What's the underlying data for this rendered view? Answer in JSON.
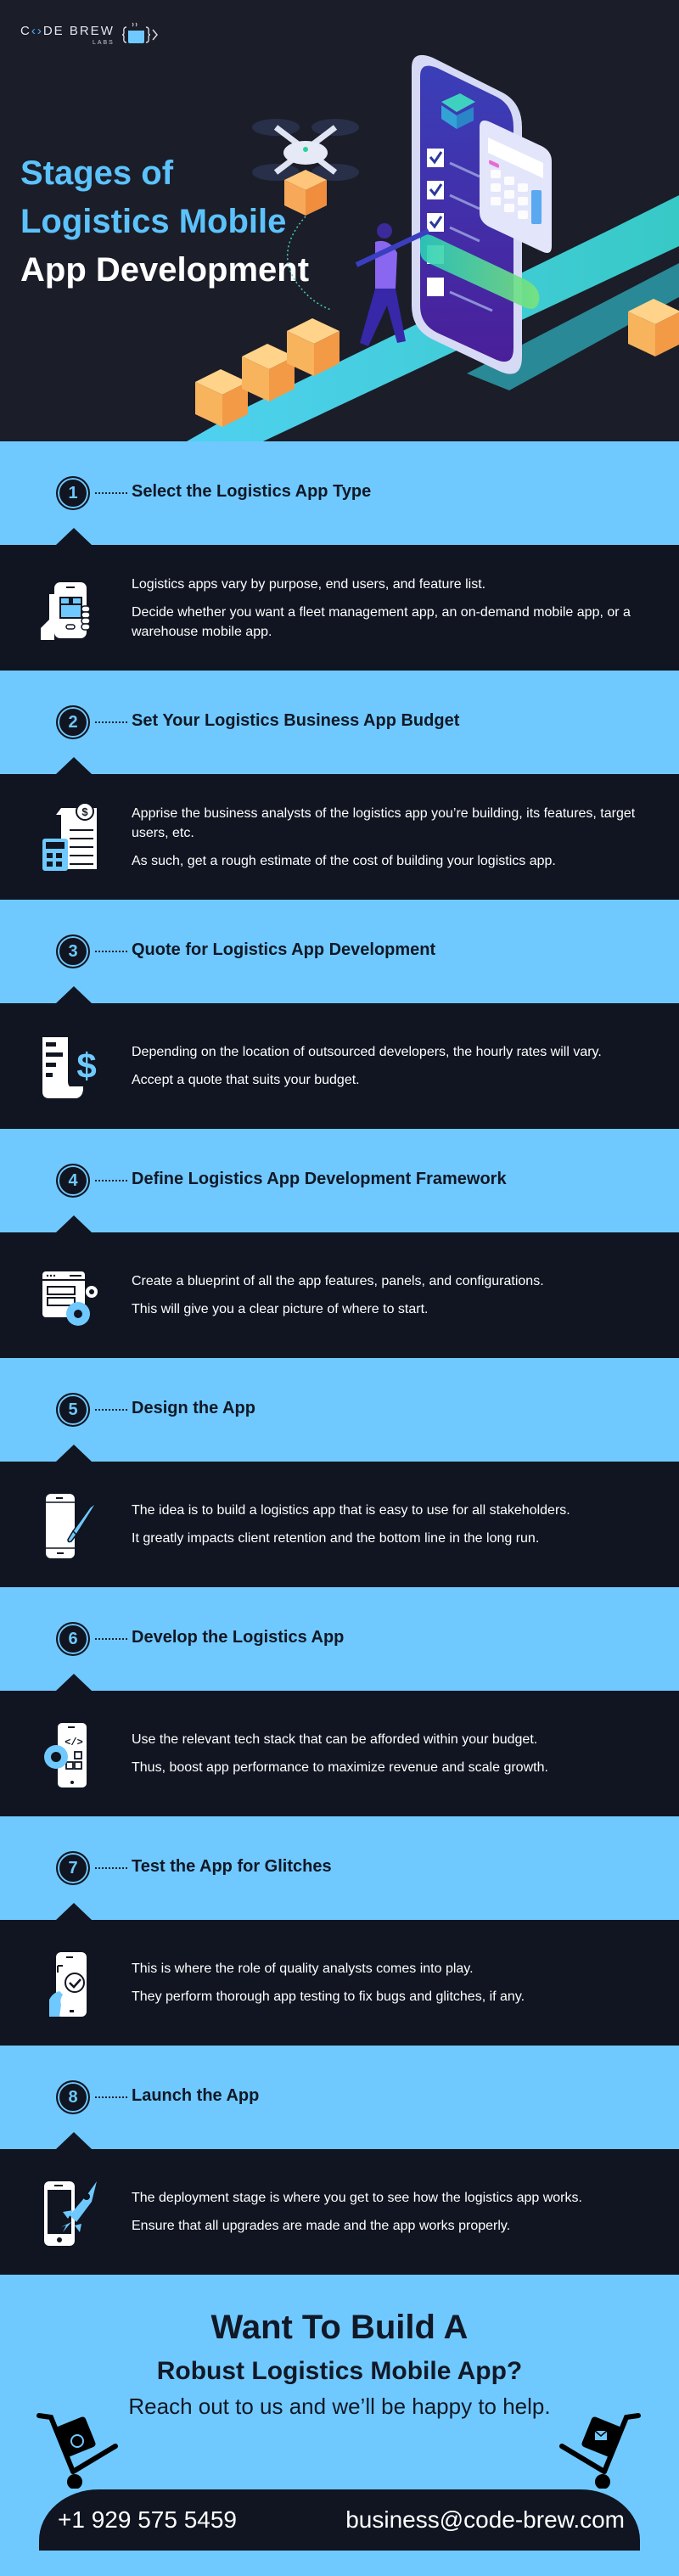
{
  "brand": {
    "name_part1": "C",
    "name_part2": "DE BREW",
    "sub": "LABS",
    "logo_icon": "coffee-cup-braces-icon"
  },
  "hero": {
    "title_line1": "Stages of",
    "title_line2": "Logistics Mobile",
    "title_line3": "App Development",
    "illustration": "isometric-phone-drone-boxes-illustration"
  },
  "colors": {
    "hero_bg": "#1b1d29",
    "band_blue": "#6fc9fe",
    "dark": "#101521",
    "accent_blue": "#5cc2fb"
  },
  "steps": [
    {
      "number": "1",
      "title": "Select the Logistics App Type",
      "icon": "hand-holding-phone-box-icon",
      "paragraphs": [
        "Logistics apps vary by purpose, end users, and feature list.",
        "Decide whether you want a fleet management app, an on-demand mobile app, or a warehouse mobile app."
      ]
    },
    {
      "number": "2",
      "title": "Set Your Logistics Business App Budget",
      "icon": "budget-calculator-document-icon",
      "paragraphs": [
        "Apprise the business analysts of the logistics app you’re building, its features, target users, etc.",
        "As such, get a rough estimate of the cost of building your logistics app."
      ]
    },
    {
      "number": "3",
      "title": "Quote for Logistics App Development",
      "icon": "invoice-dollar-icon",
      "paragraphs": [
        "Depending on the location of outsourced developers, the hourly rates will vary.",
        "Accept a quote that suits your budget."
      ]
    },
    {
      "number": "4",
      "title": "Define Logistics App Development Framework",
      "icon": "browser-window-gears-icon",
      "paragraphs": [
        "Create a blueprint of all the app features, panels, and configurations.",
        "This will give you a clear picture of where to start."
      ]
    },
    {
      "number": "5",
      "title": "Design the App",
      "icon": "phone-paintbrush-icon",
      "paragraphs": [
        "The idea is to build a logistics app that is easy to use for all stakeholders.",
        "It greatly impacts client retention and the bottom line in the long run."
      ]
    },
    {
      "number": "6",
      "title": "Develop the Logistics App",
      "icon": "phone-code-gear-icon",
      "paragraphs": [
        "Use the relevant tech stack that can be afforded within your budget.",
        "Thus, boost app performance to maximize revenue and scale growth."
      ]
    },
    {
      "number": "7",
      "title": "Test the App for Glitches",
      "icon": "phone-check-hand-icon",
      "paragraphs": [
        "This is where the role of quality analysts comes into play.",
        "They perform thorough app testing to fix bugs and glitches, if any."
      ]
    },
    {
      "number": "8",
      "title": "Launch the App",
      "icon": "phone-rocket-icon",
      "paragraphs": [
        "The deployment stage is where you get to see how the logistics app works.",
        "Ensure that all upgrades are made and the app works properly."
      ]
    }
  ],
  "cta": {
    "heading_line1": "Want To Build A",
    "heading_line2": "Robust Logistics Mobile App?",
    "subheading": "Reach out to us and we’ll be happy to help.",
    "phone": "+1 929 575 5459",
    "email": "business@code-brew.com",
    "left_icon": "hand-truck-phone-icon",
    "right_icon": "hand-truck-mail-icon"
  }
}
